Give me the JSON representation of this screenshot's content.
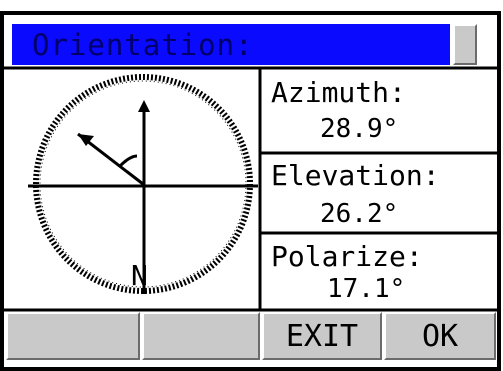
{
  "window": {
    "title": "Orientation:"
  },
  "readouts": [
    {
      "label": "Azimuth:",
      "value": "28.9°"
    },
    {
      "label": "Elevation:",
      "value": "26.2°"
    },
    {
      "label": "Polarize:",
      "value": "17.1°"
    }
  ],
  "compass": {
    "north_label": "N",
    "pointer_angle_deg": -56
  },
  "buttons": {
    "soft1": "",
    "soft2": "",
    "exit": "EXIT",
    "ok": "OK"
  },
  "colors": {
    "title_bg": "#0a0aff",
    "title_text": "#00006a",
    "button_face": "#c9c9c9"
  }
}
